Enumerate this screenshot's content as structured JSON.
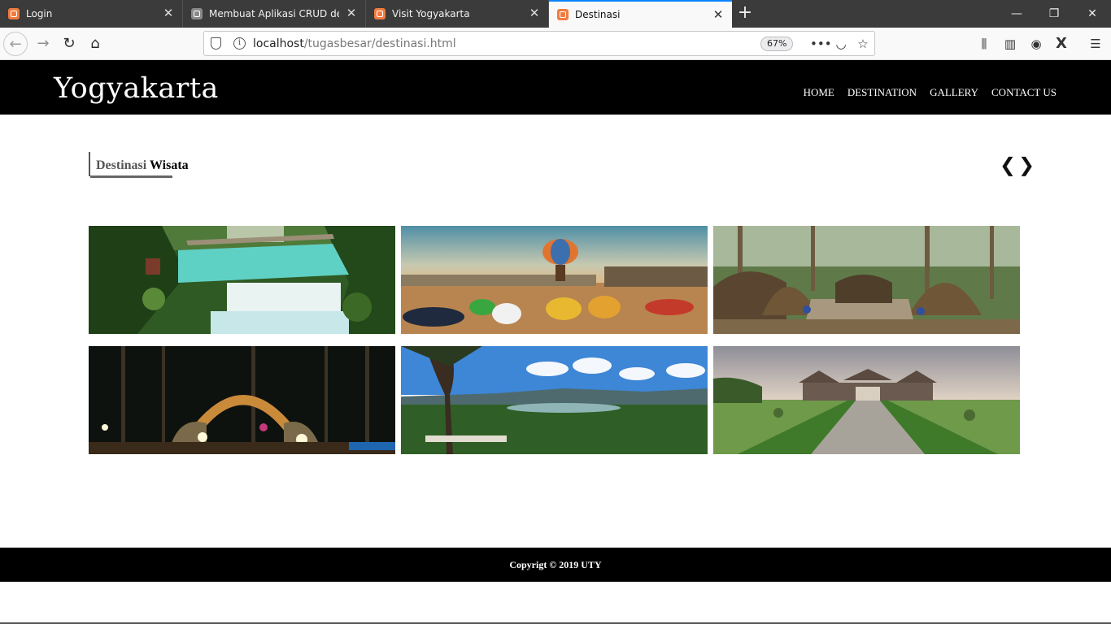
{
  "browser": {
    "tabs": [
      {
        "title": "Login",
        "active": false
      },
      {
        "title": "Membuat Aplikasi CRUD denga",
        "active": false
      },
      {
        "title": "Visit Yogyakarta",
        "active": false
      },
      {
        "title": "Destinasi",
        "active": true
      }
    ],
    "url_host": "localhost",
    "url_path": "/tugasbesar/destinasi.html",
    "zoom": "67%",
    "accent_color": "#0a84ff"
  },
  "site": {
    "brand": "Yogyakarta",
    "menu": [
      "HOME",
      "DESTINATION",
      "GALLERY",
      "CONTACT US"
    ]
  },
  "section": {
    "title_part1": "Destinasi",
    "title_part2": "Wisata",
    "prev_icon": "chevron-left-icon",
    "next_icon": "chevron-right-icon"
  },
  "destinations": [
    {
      "image": "waterfall-pool-photo"
    },
    {
      "image": "hot-air-balloon-hilltop-photo"
    },
    {
      "image": "wooden-hut-forest-photo"
    },
    {
      "image": "illuminated-arch-pine-forest-photo"
    },
    {
      "image": "lake-valley-viewpoint-photo"
    },
    {
      "image": "temple-gate-path-photo"
    }
  ],
  "footer": {
    "copyright": "Copyrigt © 2019 UTY"
  }
}
